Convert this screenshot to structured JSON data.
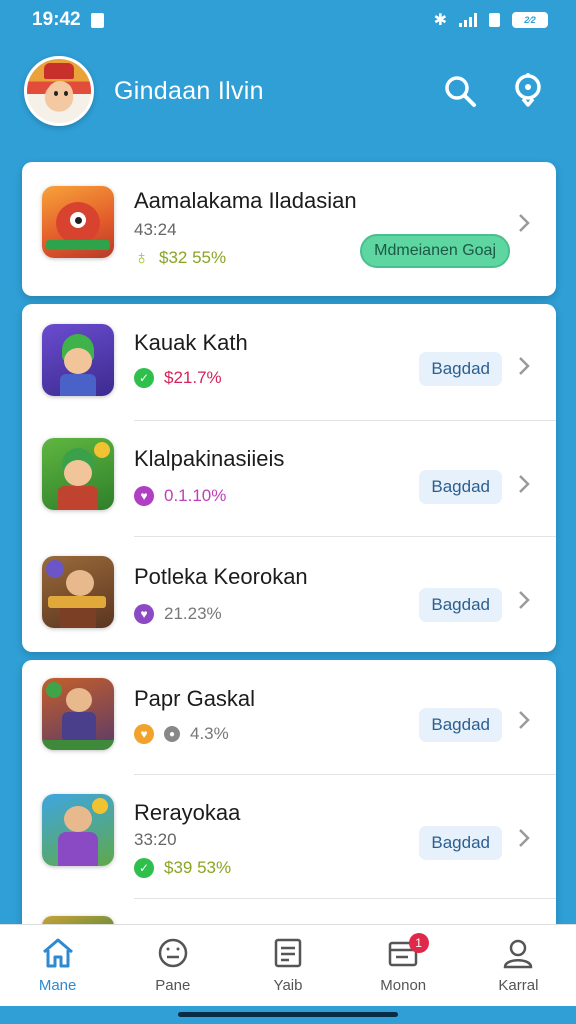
{
  "status_bar": {
    "time": "19:42",
    "battery": "2⁄2"
  },
  "header": {
    "title": "Gindaan Ilvin"
  },
  "featured": {
    "title": "Aamalakama Iladasian",
    "time": "43:24",
    "stat": "$32 55%",
    "button_label": "Mdmeianen Goaj"
  },
  "list1": [
    {
      "title": "Kauak Kath",
      "stat": "$21.7%",
      "button_label": "Bagdad",
      "stat_color": "#d4245b",
      "dot_color": "#2fbf4c"
    },
    {
      "title": "Klalpakinasiieis",
      "stat": "0.1.10%",
      "button_label": "Bagdad",
      "stat_color": "#c03fb8",
      "dot_color": "#b03fc4"
    },
    {
      "title": "Potleka Keorokan",
      "stat": "21.23%",
      "button_label": "Bagdad",
      "stat_color": "#777777",
      "dot_color": "#8d48c4"
    }
  ],
  "list2": [
    {
      "title": "Papr Gaskal",
      "stat": "4.3%",
      "button_label": "Bagdad"
    },
    {
      "title": "Rerayokaa",
      "time": "33:20",
      "stat": "$39 53%",
      "button_label": "Bagdad"
    }
  ],
  "nav": {
    "items": [
      {
        "label": "Mane"
      },
      {
        "label": "Pane"
      },
      {
        "label": "Yaib"
      },
      {
        "label": "Monon",
        "badge": "1"
      },
      {
        "label": "Karral"
      }
    ]
  }
}
